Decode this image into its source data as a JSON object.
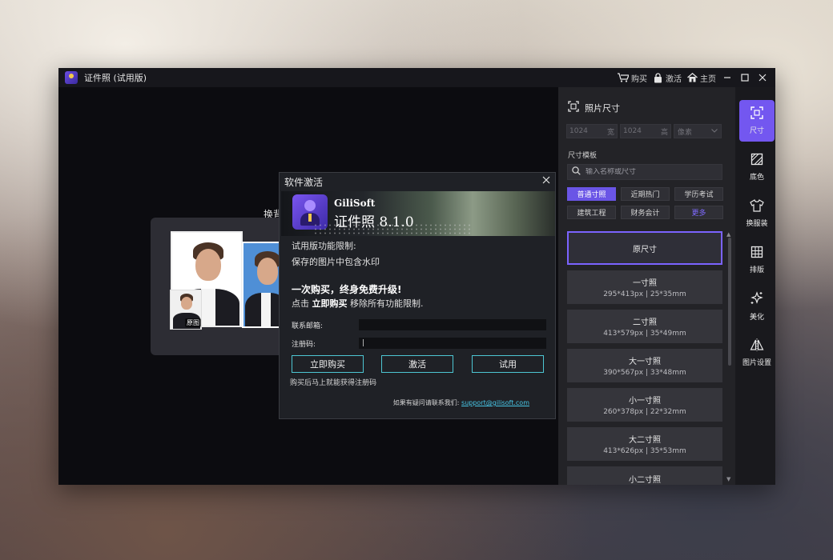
{
  "window": {
    "title": "证件照 (试用版)",
    "buy_label": "购买",
    "activate_label": "激活",
    "home_label": "主页"
  },
  "main": {
    "hint_text": "换背",
    "original_tag": "原图"
  },
  "dialog": {
    "title": "软件激活",
    "brand": "GiliSoft",
    "product": "证件照 8.1.0",
    "trial_limit_title": "试用版功能限制:",
    "trial_limit_item": "保存的图片中包含水印",
    "promo_line1": "一次购买，终身免费升级!",
    "promo_line2_prefix": "点击",
    "promo_line2_bold": "立即购买",
    "promo_line2_suffix": "移除所有功能限制.",
    "email_label": "联系邮箱:",
    "email_value": "",
    "code_label": "注册码:",
    "code_value": "|",
    "buy_button": "立即购买",
    "activate_button": "激活",
    "trial_button": "试用",
    "note": "购买后马上就能获得注册码",
    "contact_prefix": "如果有疑问请联系我们:",
    "contact_email": "support@gilisoft.com"
  },
  "right_panel": {
    "title": "照片尺寸",
    "width_value": "1024",
    "width_unit": "宽",
    "height_value": "1024",
    "height_unit": "高",
    "unit_select": "像素",
    "template_label": "尺寸模板",
    "search_placeholder": "输入名称或尺寸",
    "chips": [
      "普通寸照",
      "近期热门",
      "学历考试",
      "建筑工程",
      "财务会计",
      "更多"
    ],
    "sizes": [
      {
        "name": "原尺寸",
        "spec": ""
      },
      {
        "name": "一寸照",
        "spec": "295*413px | 25*35mm"
      },
      {
        "name": "二寸照",
        "spec": "413*579px | 35*49mm"
      },
      {
        "name": "大一寸照",
        "spec": "390*567px | 33*48mm"
      },
      {
        "name": "小一寸照",
        "spec": "260*378px | 22*32mm"
      },
      {
        "name": "大二寸照",
        "spec": "413*626px | 35*53mm"
      },
      {
        "name": "小二寸照",
        "spec": ""
      }
    ]
  },
  "tools": [
    {
      "label": "尺寸",
      "icon": "crop-frame-icon"
    },
    {
      "label": "底色",
      "icon": "background-color-icon"
    },
    {
      "label": "换服装",
      "icon": "shirt-icon"
    },
    {
      "label": "排版",
      "icon": "grid-layout-icon"
    },
    {
      "label": "美化",
      "icon": "sparkle-icon"
    },
    {
      "label": "图片设置",
      "icon": "flip-icon"
    }
  ],
  "colors": {
    "accent": "#7357f0",
    "link": "#48c6e6",
    "button_border": "#4dc6d3"
  }
}
